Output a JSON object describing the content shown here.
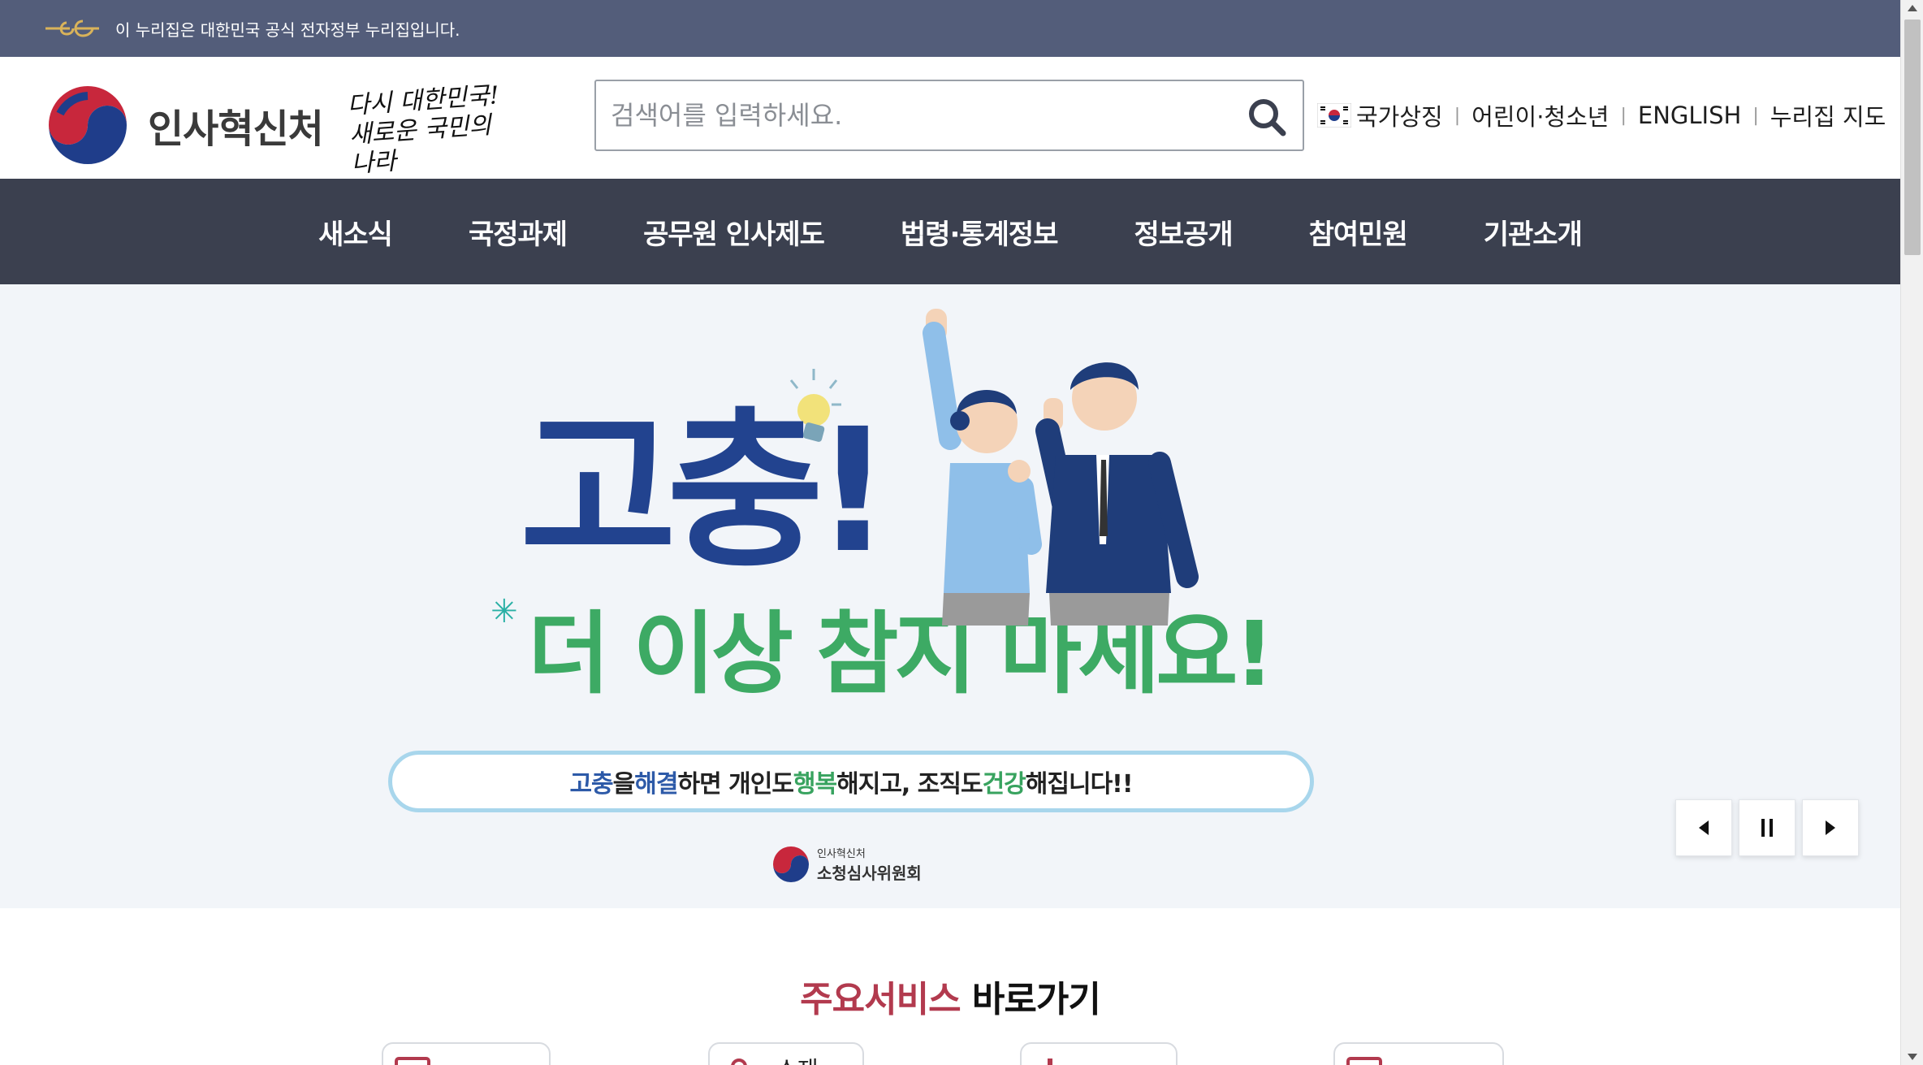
{
  "gov_banner": {
    "text": "이 누리집은 대한민국 공식 전자정부 누리집입니다.",
    "logo_icon": "egov-logo-icon"
  },
  "header": {
    "org_name": "인사혁신처",
    "slogan_line1": "다시 대한민국!",
    "slogan_line2": "새로운 국민의 나라",
    "search": {
      "placeholder": "검색어를 입력하세요.",
      "value": "",
      "icon": "search-icon"
    },
    "util_links": {
      "national_symbol": "국가상징",
      "children": "어린이·청소년",
      "english": "ENGLISH",
      "sitemap": "누리집 지도"
    }
  },
  "gnb": {
    "items": [
      "새소식",
      "국정과제",
      "공무원 인사제도",
      "법령·통계정보",
      "정보공개",
      "참여민원",
      "기관소개"
    ]
  },
  "banner": {
    "title": "고충!",
    "subtitle": "더 이상 참지 마세요!",
    "tagline": {
      "w1": "고충",
      "w2": "을 ",
      "w3": "해결",
      "w4": "하면 개인도 ",
      "w5": "행복",
      "w6": "해지고, 조직도 ",
      "w7": "건강",
      "w8": "해집니다!!"
    },
    "committee_org": "인사혁신처",
    "committee_name": "소청심사위원회"
  },
  "slider_controls": {
    "prev_icon": "prev-icon",
    "pause_icon": "pause-icon",
    "next_icon": "next-icon"
  },
  "services": {
    "title_accent": "주요서비스",
    "title_rest": " 바로가기",
    "cards": [
      "",
      "소재",
      "",
      ""
    ]
  },
  "colors": {
    "gov_bar": "#535d7a",
    "gnb": "#3b404f",
    "title_blue": "#22438f",
    "subtitle_green": "#3daa64",
    "accent_red": "#b23a4e"
  }
}
